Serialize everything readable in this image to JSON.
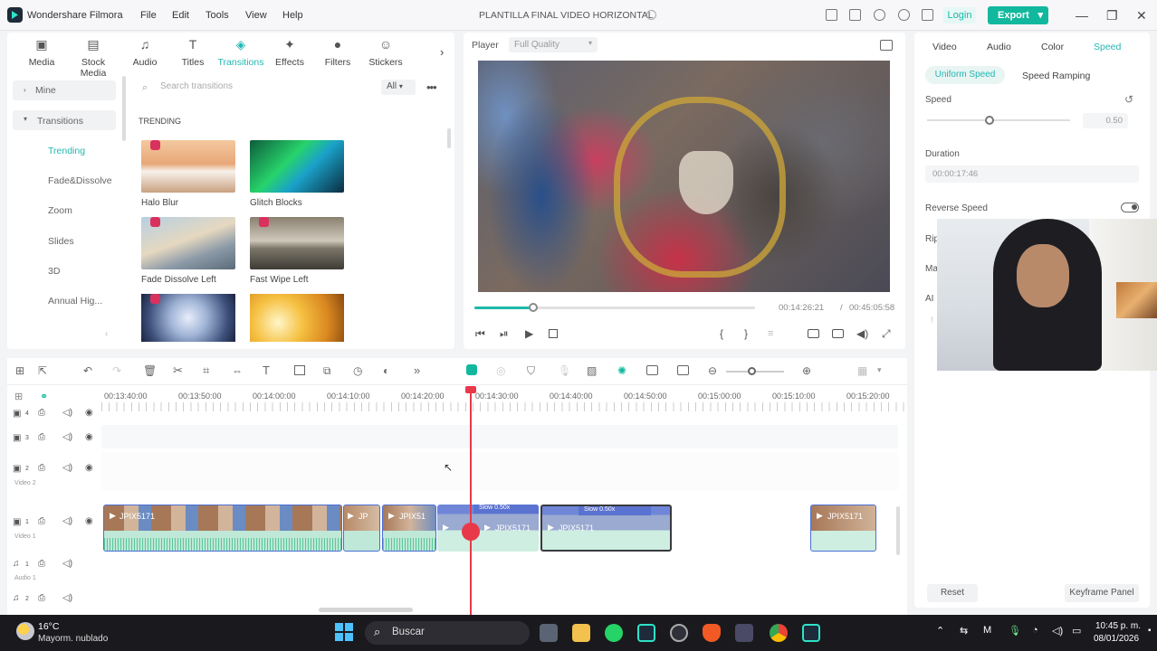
{
  "app": {
    "title": "Wondershare Filmora",
    "project": "PLANTILLA FINAL VIDEO HORIZONTAL",
    "menu": [
      "File",
      "Edit",
      "Tools",
      "View",
      "Help"
    ],
    "login": "Login",
    "export": "Export"
  },
  "toolbar": {
    "items": [
      {
        "label": "Media",
        "icon": "media-icon"
      },
      {
        "label": "Stock Media",
        "icon": "stock-media-icon"
      },
      {
        "label": "Audio",
        "icon": "music-note-icon"
      },
      {
        "label": "Titles",
        "icon": "text-icon"
      },
      {
        "label": "Transitions",
        "icon": "transitions-icon"
      },
      {
        "label": "Effects",
        "icon": "effects-icon"
      },
      {
        "label": "Filters",
        "icon": "filters-icon"
      },
      {
        "label": "Stickers",
        "icon": "stickers-icon"
      }
    ]
  },
  "categories": {
    "mine": "Mine",
    "transitions": "Transitions",
    "items": [
      "Trending",
      "Fade&Dissolve",
      "Zoom",
      "Slides",
      "3D",
      "Annual Hig..."
    ]
  },
  "search": {
    "placeholder": "Search transitions",
    "filter": "All"
  },
  "library": {
    "section": "TRENDING",
    "items": [
      "Halo Blur",
      "Glitch Blocks",
      "Fade Dissolve Left",
      "Fast Wipe Left",
      "",
      ""
    ]
  },
  "player": {
    "label": "Player",
    "quality": "Full Quality",
    "current": "00:14:26:21",
    "separator": "/",
    "total": "00:45:05:58",
    "progress": 0.21
  },
  "properties": {
    "tabs": [
      "Video",
      "Audio",
      "Color",
      "Speed"
    ],
    "subtabs": [
      "Uniform Speed",
      "Speed Ramping"
    ],
    "speed_label": "Speed",
    "speed_value": "0.50",
    "duration_label": "Duration",
    "duration_value": "00:00:17:46",
    "reverse_label": "Reverse Speed",
    "partial": [
      "Rip",
      "Ma",
      "AI",
      "!"
    ],
    "reset": "Reset",
    "keyframe": "Keyframe Panel"
  },
  "timeline": {
    "ruler": [
      "00:13:40:00",
      "00:13:50:00",
      "00:14:00:00",
      "00:14:10:00",
      "00:14:20:00",
      "00:14:30:00",
      "00:14:40:00",
      "00:14:50:00",
      "00:15:00:00",
      "00:15:10:00",
      "00:15:20:00"
    ],
    "tracks": [
      {
        "num": "4",
        "name": ""
      },
      {
        "num": "3",
        "name": ""
      },
      {
        "num": "2",
        "name": "Video 2"
      },
      {
        "num": "1",
        "name": "Video 1"
      },
      {
        "num": "1",
        "name": "Audio 1"
      },
      {
        "num": "2",
        "name": ""
      }
    ],
    "clips": [
      "JPIX5171",
      "JP",
      "JPIX51",
      "JPIX5171",
      "JPIX5171",
      "JPIX5171"
    ],
    "speed_badges": [
      "Slow 0.50x",
      "Slow 0.50x"
    ]
  },
  "taskbar": {
    "temp": "16°C",
    "weather": "Mayorm. nublado",
    "search": "Buscar",
    "time": "10:45 p. m.",
    "date": "08/01/2026"
  },
  "colors": {
    "accent": "#12b89e",
    "playhead": "#e8394a",
    "clip": "#4c6fd6",
    "waveform": "#bfe8d8"
  }
}
